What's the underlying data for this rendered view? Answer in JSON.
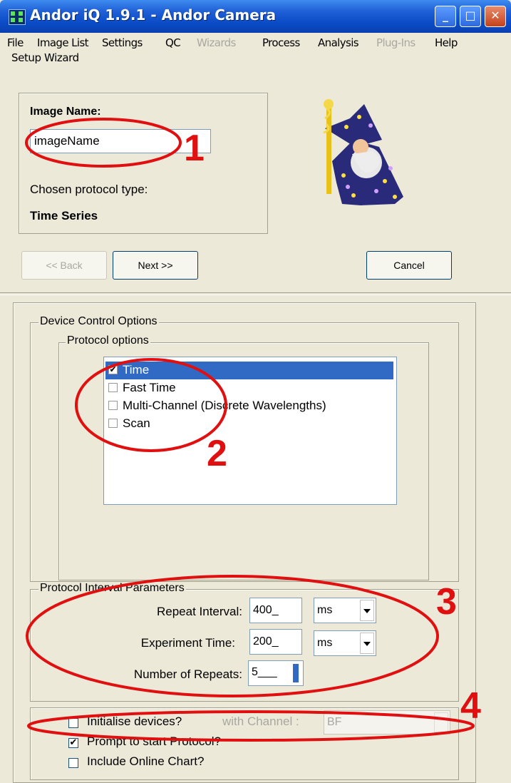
{
  "window": {
    "title": "Andor iQ 1.9.1 - Andor Camera",
    "min_label": "_",
    "max_label": "□",
    "close_label": "✕"
  },
  "menu": [
    "File",
    "Image List",
    "Settings",
    "QC",
    "Wizards",
    "Process",
    "Analysis",
    "Plug-Ins",
    "Help"
  ],
  "menu_disabled": [
    "Wizards",
    "Plug-Ins"
  ],
  "wizard": {
    "frame_label": "Setup Wizard",
    "image_name_label": "Image Name:",
    "image_name_value": "imageName",
    "protocol_type_label": "Chosen protocol type:",
    "protocol_type_value": "Time Series",
    "back_label": "<< Back",
    "next_label": "Next >>",
    "cancel_label": "Cancel"
  },
  "device_control": {
    "title": "Device Control Options",
    "protocol_options_title": "Protocol options",
    "protocol_options": [
      {
        "label": "Time",
        "checked": true,
        "selected": true
      },
      {
        "label": "Fast Time",
        "checked": false,
        "selected": false
      },
      {
        "label": "Multi-Channel (Discrete Wavelengths)",
        "checked": false,
        "selected": false
      },
      {
        "label": "Scan",
        "checked": false,
        "selected": false
      }
    ]
  },
  "interval_params": {
    "title": "Protocol Interval Parameters",
    "repeat_interval_label": "Repeat Interval:",
    "repeat_interval_value": "400_",
    "repeat_interval_unit": "ms",
    "experiment_time_label": "Experiment Time:",
    "experiment_time_value": "200_",
    "experiment_time_unit": "ms",
    "repeats_label": "Number of Repeats:",
    "repeats_value": "5___"
  },
  "init": {
    "initialise_label": "Initialise devices?",
    "initialise_checked": false,
    "channel_label": "with Channel :",
    "channel_value": "BF",
    "prompt_label": "Prompt to start Protocol?",
    "prompt_checked": true,
    "chart_label": "Include Online Chart?",
    "chart_checked": false
  },
  "annotations": {
    "n1": "1",
    "n2": "2",
    "n3": "3",
    "n4": "4",
    "color": "#e01010"
  },
  "colors": {
    "titlebar": "#0a4cc7",
    "selection": "#316ac5",
    "face": "#ece9d8"
  }
}
